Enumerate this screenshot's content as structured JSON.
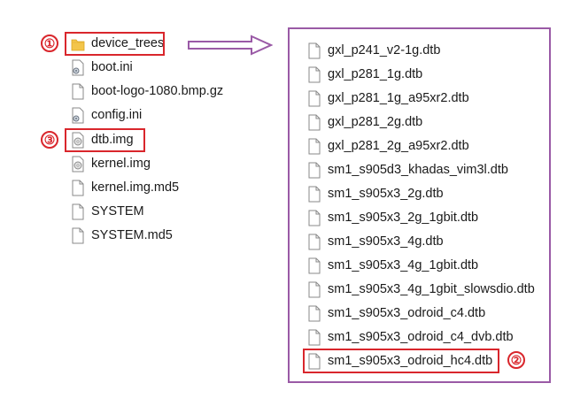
{
  "left_list": {
    "items": [
      {
        "label": "device_trees",
        "icon": "folder-icon"
      },
      {
        "label": "boot.ini",
        "icon": "settings-file-icon"
      },
      {
        "label": "boot-logo-1080.bmp.gz",
        "icon": "file-icon"
      },
      {
        "label": "config.ini",
        "icon": "settings-file-icon"
      },
      {
        "label": "dtb.img",
        "icon": "disc-image-icon"
      },
      {
        "label": "kernel.img",
        "icon": "disc-image-icon"
      },
      {
        "label": "kernel.img.md5",
        "icon": "file-icon"
      },
      {
        "label": "SYSTEM",
        "icon": "file-icon"
      },
      {
        "label": "SYSTEM.md5",
        "icon": "file-icon"
      }
    ]
  },
  "right_list": {
    "items": [
      {
        "label": "gxl_p241_v2-1g.dtb",
        "icon": "file-icon"
      },
      {
        "label": "gxl_p281_1g.dtb",
        "icon": "file-icon"
      },
      {
        "label": "gxl_p281_1g_a95xr2.dtb",
        "icon": "file-icon"
      },
      {
        "label": "gxl_p281_2g.dtb",
        "icon": "file-icon"
      },
      {
        "label": "gxl_p281_2g_a95xr2.dtb",
        "icon": "file-icon"
      },
      {
        "label": "sm1_s905d3_khadas_vim3l.dtb",
        "icon": "file-icon"
      },
      {
        "label": "sm1_s905x3_2g.dtb",
        "icon": "file-icon"
      },
      {
        "label": "sm1_s905x3_2g_1gbit.dtb",
        "icon": "file-icon"
      },
      {
        "label": "sm1_s905x3_4g.dtb",
        "icon": "file-icon"
      },
      {
        "label": "sm1_s905x3_4g_1gbit.dtb",
        "icon": "file-icon"
      },
      {
        "label": "sm1_s905x3_4g_1gbit_slowsdio.dtb",
        "icon": "file-icon"
      },
      {
        "label": "sm1_s905x3_odroid_c4.dtb",
        "icon": "file-icon"
      },
      {
        "label": "sm1_s905x3_odroid_c4_dvb.dtb",
        "icon": "file-icon"
      },
      {
        "label": "sm1_s905x3_odroid_hc4.dtb",
        "icon": "file-icon"
      }
    ]
  },
  "markers": {
    "one": "①",
    "two": "②",
    "three": "③"
  },
  "colors": {
    "highlight": "#d9262c",
    "panel_border": "#9a5aa6",
    "folder": "#f3c54a"
  }
}
